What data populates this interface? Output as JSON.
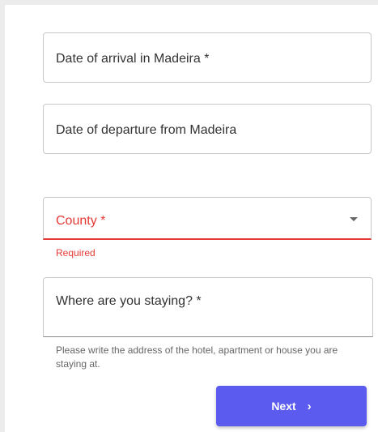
{
  "form": {
    "arrival": {
      "label": "Date of arrival in Madeira *"
    },
    "departure": {
      "label": "Date of departure from Madeira"
    },
    "county": {
      "label": "County *",
      "error": "Required"
    },
    "staying": {
      "label": "Where are you staying? *",
      "helper": "Please write the address of the hotel, apartment or house you are staying at."
    },
    "next_button": {
      "label": "Next",
      "icon": "chevron-right-icon",
      "icon_glyph": "›"
    }
  },
  "colors": {
    "accent": "#5b5bef",
    "error": "#e53935",
    "border": "#c8c8c8"
  }
}
